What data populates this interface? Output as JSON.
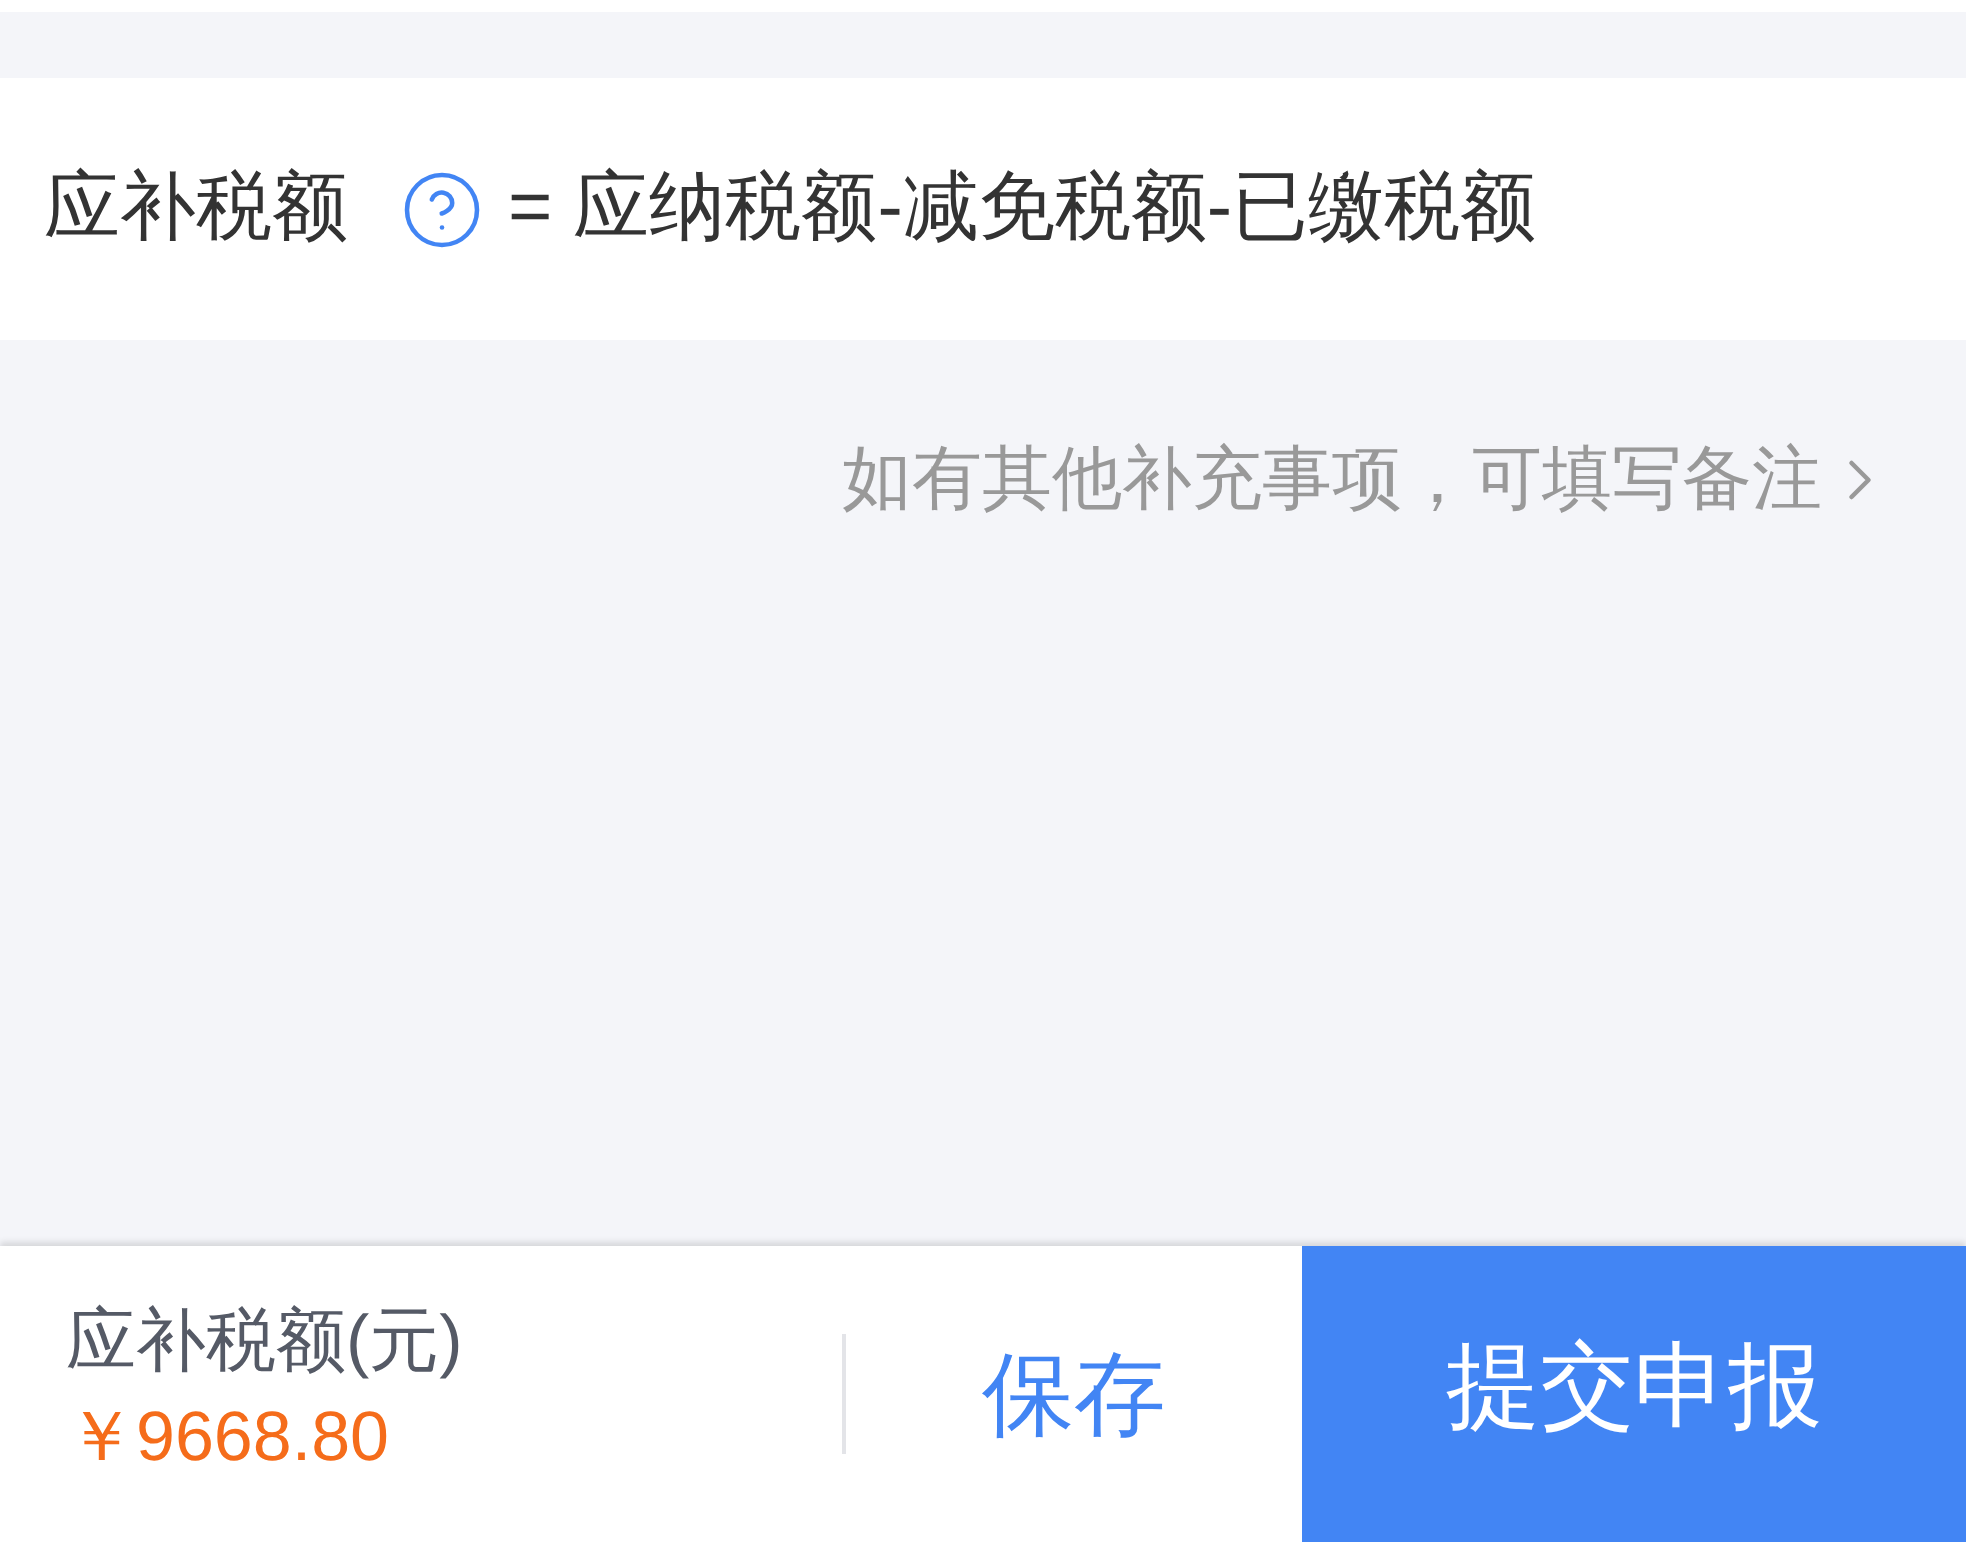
{
  "formula": {
    "label": "应补税额",
    "text": "= 应纳税额-减免税额-已缴税额"
  },
  "remark_link": {
    "text": "如有其他补充事项，可填写备注"
  },
  "footer": {
    "amount_label": "应补税额(元)",
    "amount": "￥9668.80",
    "buttons": [
      {
        "label": "保存",
        "kind": "secondary"
      },
      {
        "label": "提交申报",
        "kind": "primary"
      }
    ]
  }
}
